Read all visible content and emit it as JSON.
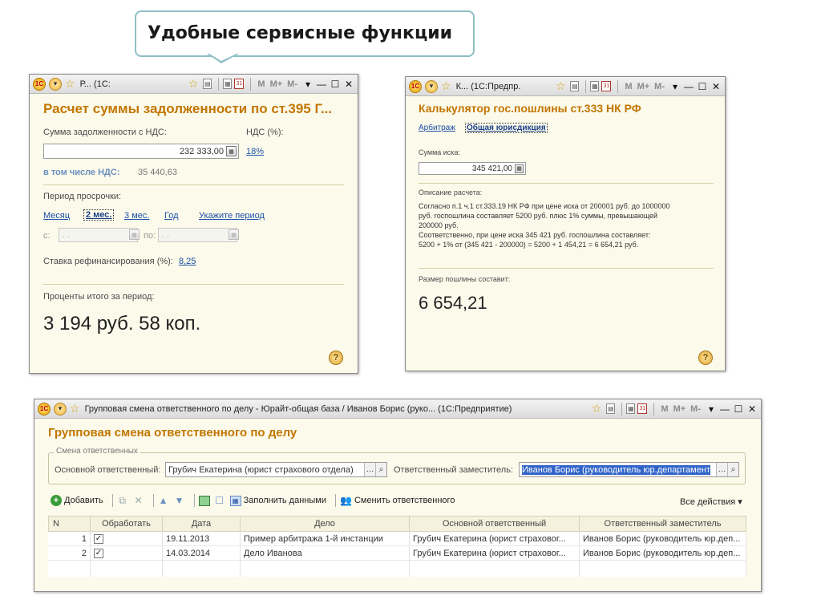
{
  "slide": {
    "heading": "Удобные сервисные функции"
  },
  "win1": {
    "titlebar": {
      "title": "Р...  (1С:",
      "m1": "M",
      "m2": "M+",
      "m3": "M-"
    },
    "form_title": "Расчет суммы задолженности по ст.395 Г...",
    "debt_label": "Сумма задолженности с НДС:",
    "vat_label": "НДС (%):",
    "debt_value": "232 333,00",
    "vat_link": "18%",
    "incl_vat_label": "в том числе НДС:",
    "incl_vat_value": "35 440,63",
    "overdue_label": "Период просрочки:",
    "periods": [
      "Месяц",
      "2 мес.",
      "3 мес.",
      "Год",
      "Укажите период"
    ],
    "from_label": "с:",
    "to_label": "по:",
    "date_placeholder": ". .",
    "rate_label": "Ставка рефинансирования (%):",
    "rate_value": "8,25",
    "total_label": "Проценты итого за период:",
    "total_value": "3 194 руб. 58 коп."
  },
  "win2": {
    "titlebar": {
      "title": "К...  (1С:Предпр.",
      "m1": "M",
      "m2": "M+",
      "m3": "M-"
    },
    "form_title": "Калькулятор гос.пошлины ст.333 НК РФ",
    "tab_arb": "Арбитраж",
    "tab_general": "Общая юрисдикция",
    "claim_label": "Сумма иска:",
    "claim_value": "345 421,00",
    "desc_label": "Описание расчета:",
    "desc_lines": [
      "Согласно п.1 ч.1 ст.333.19 НК РФ при цене иска от 200001 руб. до 1000000",
      "руб. госпошлина составляет 5200 руб. плюс 1% суммы, превышающей",
      "200000 руб.",
      "Соответственно, при цене иска 345 421 руб. госпошлина составляет:",
      "5200 + 1% от (345 421 - 200000) = 5200 + 1 454,21 = 6 654,21 руб."
    ],
    "fee_label": "Размер пошлины составит:",
    "fee_value": "6 654,21"
  },
  "win3": {
    "titlebar": {
      "title": "Групповая смена ответственного по делу - Юрайт-общая база / Иванов Борис (руко...  (1С:Предприятие)",
      "m1": "M",
      "m2": "M+",
      "m3": "M-"
    },
    "form_title": "Групповая смена ответственного по делу",
    "group_label": "Смена ответственных",
    "main_resp_label": "Основной ответственный:",
    "main_resp_value": "Грубич Екатерина (юрист страхового отдела)",
    "deputy_label": "Ответственный заместитель:",
    "deputy_value": "Иванов Борис (руководитель юр.департамент",
    "toolbar": {
      "add": "Добавить",
      "fill": "Заполнить данными",
      "change": "Сменить ответственного",
      "all_actions": "Все действия"
    },
    "columns": [
      "N",
      "Обработать",
      "Дата",
      "Дело",
      "Основной ответственный",
      "Ответственный заместитель"
    ],
    "rows": [
      {
        "n": "1",
        "checked": true,
        "date": "19.11.2013",
        "case": "Пример арбитража 1-й инстанции",
        "main": "Грубич Екатерина (юрист страховог...",
        "deputy": "Иванов Борис (руководитель юр.деп..."
      },
      {
        "n": "2",
        "checked": true,
        "date": "14.03.2014",
        "case": "Дело Иванова",
        "main": "Грубич Екатерина (юрист страховог...",
        "deputy": "Иванов Борис (руководитель юр.деп..."
      }
    ]
  }
}
